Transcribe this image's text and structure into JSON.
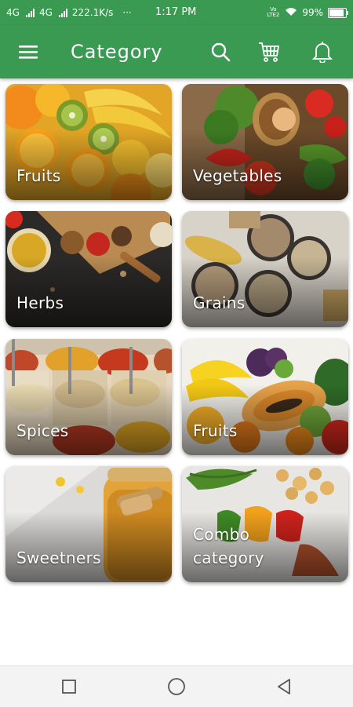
{
  "status_bar": {
    "network1": "4G",
    "network2": "4G",
    "speed": "222.1K/s",
    "dots": "···",
    "time": "1:17 PM",
    "volte": "Vo LTE2",
    "battery": "99%"
  },
  "app_bar": {
    "title": "Category",
    "icons": [
      "menu-icon",
      "search-icon",
      "cart-icon",
      "bell-icon"
    ],
    "color": "#3a9a52"
  },
  "categories": [
    {
      "label": "Fruits"
    },
    {
      "label": "Vegetables"
    },
    {
      "label": "Herbs"
    },
    {
      "label": "Grains"
    },
    {
      "label": "Spices"
    },
    {
      "label": "Fruits"
    },
    {
      "label": "Sweetners"
    },
    {
      "label_line1": "Combo",
      "label_line2": "category"
    }
  ],
  "nav_bar": {
    "icons": [
      "recents-icon",
      "home-icon",
      "back-icon"
    ]
  }
}
